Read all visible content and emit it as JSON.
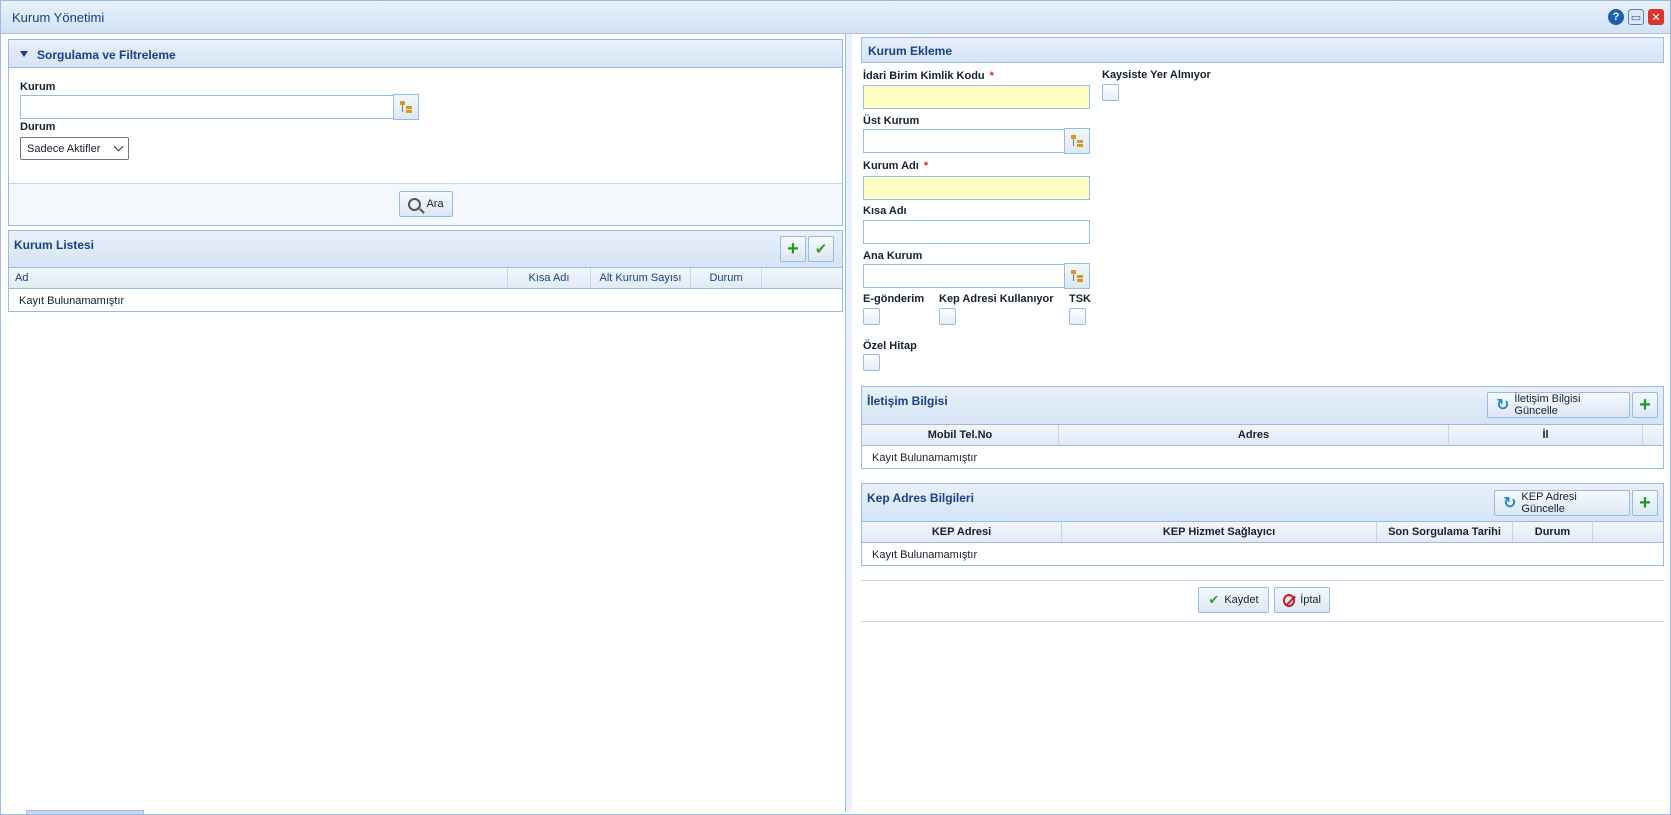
{
  "window": {
    "title": "Kurum Yönetimi",
    "help_icon": "?",
    "close_icon": "✕"
  },
  "filter": {
    "title": "Sorgulama ve Filtreleme",
    "kurum_label": "Kurum",
    "kurum_value": "",
    "durum_label": "Durum",
    "durum_selected": "Sadece Aktifler",
    "search_label": "Ara"
  },
  "list": {
    "title": "Kurum Listesi",
    "columns": [
      "Ad",
      "Kısa Adı",
      "Alt Kurum Sayısı",
      "Durum"
    ],
    "empty_text": "Kayıt Bulunamamıştır"
  },
  "form": {
    "title": "Kurum Ekleme",
    "idari_label": "İdari Birim Kimlik Kodu",
    "required_mark": "*",
    "kaysis_label": "Kaysiste Yer Almıyor",
    "ust_kurum_label": "Üst Kurum",
    "kurum_adi_label": "Kurum Adı",
    "kisa_adi_label": "Kısa Adı",
    "ana_kurum_label": "Ana Kurum",
    "egonderim_label": "E-gönderim",
    "kep_kullaniyor_label": "Kep Adresi Kullanıyor",
    "tsk_label": "TSK",
    "ozel_hitap_label": "Özel Hitap"
  },
  "contact": {
    "title": "İletişim Bilgisi",
    "update_label": "İletişim Bilgisi Güncelle",
    "columns": [
      "Mobil Tel.No",
      "Adres",
      "İl"
    ],
    "empty_text": "Kayıt Bulunamamıştır"
  },
  "kep": {
    "title": "Kep Adres Bilgileri",
    "update_label": "KEP Adresi Güncelle",
    "columns": [
      "KEP Adresi",
      "KEP Hizmet Sağlayıcı",
      "Son Sorgulama Tarihi",
      "Durum"
    ],
    "empty_text": "Kayıt Bulunamamıştır"
  },
  "actions": {
    "save_label": "Kaydet",
    "cancel_label": "İptal"
  }
}
